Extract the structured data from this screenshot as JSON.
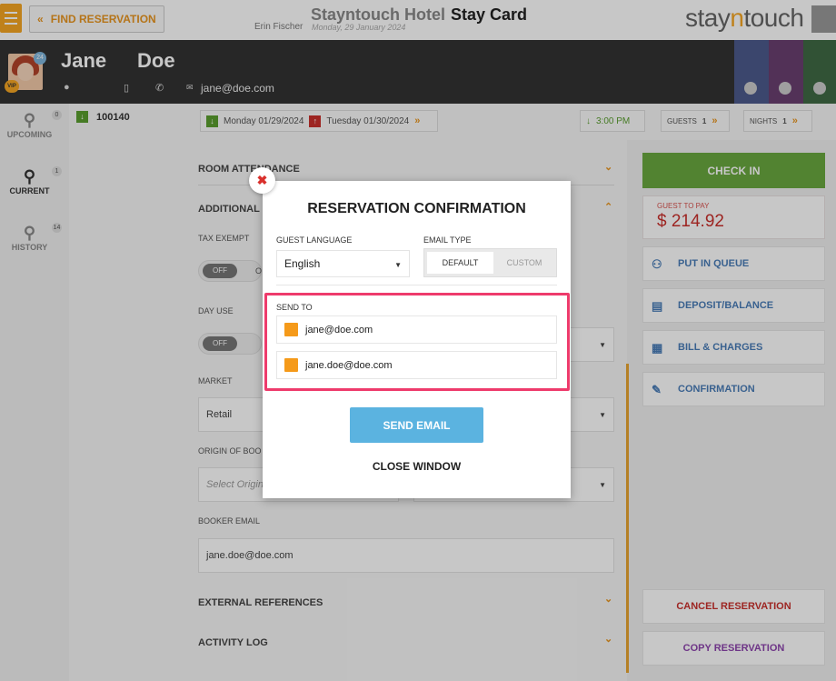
{
  "header": {
    "find_reservation": "FIND RESERVATION",
    "hotel_name": "Stayntouch Hotel",
    "page_title": "Stay Card",
    "staff_name": "Erin Fischer",
    "current_date": "Monday, 29 January 2024",
    "logo_part1": "stay",
    "logo_part2": "n",
    "logo_part3": "touch"
  },
  "guest": {
    "first_name": "Jane",
    "last_name": "Doe",
    "badge_count": "24",
    "vip": "VIP",
    "email": "jane@doe.com"
  },
  "sidenav": {
    "upcoming": "UPCOMING",
    "upcoming_count": "0",
    "current": "CURRENT",
    "current_count": "1",
    "history": "HISTORY",
    "history_count": "14"
  },
  "reservation": {
    "number": "100140",
    "arrival": "Monday 01/29/2024",
    "departure": "Tuesday 01/30/2024",
    "time": "3:00 PM",
    "guests_label": "GUESTS",
    "guests_value": "1",
    "nights_label": "NIGHTS",
    "nights_value": "1"
  },
  "main": {
    "room_attendance": "ROOM ATTENDANCE",
    "additional": "ADDITIONAL D",
    "tax_exempt": "TAX EXEMPT",
    "toggle_off": "OFF",
    "toggle_on_partial": "O",
    "day_use": "DAY USE",
    "market": "MARKET",
    "market_value": "Retail",
    "origin": "ORIGIN OF BOO",
    "origin_placeholder": "Select Origin",
    "booker_email_label": "BOOKER EMAIL",
    "booker_email": "jane.doe@doe.com",
    "external_refs": "EXTERNAL REFERENCES",
    "activity_log": "ACTIVITY LOG"
  },
  "actions": {
    "check_in": "CHECK IN",
    "guest_to_pay_label": "GUEST TO PAY",
    "guest_to_pay_amount": "$ 214.92",
    "put_in_queue": "PUT IN QUEUE",
    "deposit_balance": "DEPOSIT/BALANCE",
    "bill_charges": "BILL & CHARGES",
    "confirmation": "CONFIRMATION",
    "cancel_reservation": "CANCEL RESERVATION",
    "copy_reservation": "COPY RESERVATION"
  },
  "modal": {
    "title": "RESERVATION CONFIRMATION",
    "guest_language_label": "GUEST LANGUAGE",
    "guest_language_value": "English",
    "email_type_label": "EMAIL TYPE",
    "email_type_default": "DEFAULT",
    "email_type_custom": "CUSTOM",
    "send_to_label": "SEND TO",
    "recipients": [
      "jane@doe.com",
      "jane.doe@doe.com"
    ],
    "send_email": "SEND EMAIL",
    "close_window": "CLOSE WINDOW"
  },
  "colors": {
    "accent": "#f5a623",
    "checkin_green": "#6aa83f",
    "link_blue": "#4a7db8",
    "send_button": "#5bb3e0",
    "highlight": "#ee3b6c",
    "cancel_red": "#c9302c",
    "copy_purple": "#8e44ad"
  }
}
